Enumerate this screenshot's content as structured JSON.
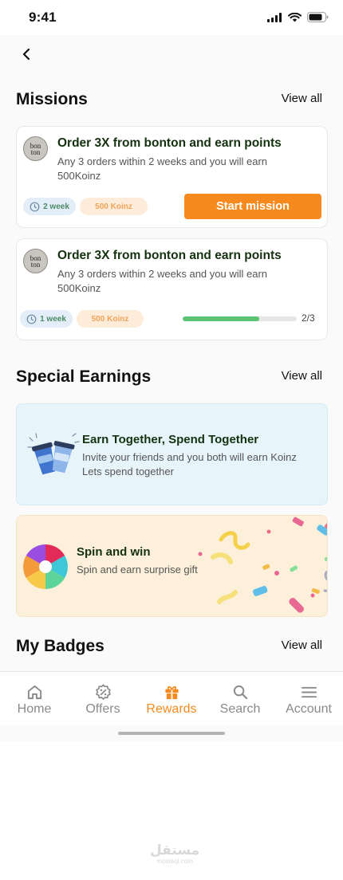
{
  "status_bar": {
    "time": "9:41"
  },
  "missions": {
    "title": "Missions",
    "view_all": "View all",
    "items": [
      {
        "logo_text": [
          "bon",
          "ton"
        ],
        "title": "Order 3X from bonton and earn points",
        "description": "Any 3 orders within 2 weeks and you will earn 500Koinz",
        "duration": "2 week",
        "reward": "500 Koinz",
        "action_label": "Start mission"
      },
      {
        "logo_text": [
          "bon",
          "ton"
        ],
        "title": "Order 3X from bonton and earn points",
        "description": "Any 3 orders within 2 weeks and you will earn 500Koinz",
        "duration": "1 week",
        "reward": "500 Koinz",
        "progress_fraction": 0.67,
        "progress_text": "2/3"
      }
    ]
  },
  "special_earnings": {
    "title": "Special Earnings",
    "view_all": "View all",
    "items": [
      {
        "title": "Earn Together, Spend Together",
        "description_line1": "Invite your friends and you both will earn Koinz",
        "description_line2": "Lets spend together",
        "icon": "coffee-cups-icon",
        "background": "#e7f5fb"
      },
      {
        "title": "Spin and win",
        "description": "Spin and earn surprise gift",
        "icon": "spin-wheel-icon",
        "background": "#fdf0db"
      }
    ]
  },
  "badges": {
    "title": "My Badges",
    "view_all": "View all"
  },
  "tab_bar": {
    "active": "Rewards",
    "items": [
      {
        "label": "Home",
        "icon": "home-icon"
      },
      {
        "label": "Offers",
        "icon": "offers-icon"
      },
      {
        "label": "Rewards",
        "icon": "gift-icon"
      },
      {
        "label": "Search",
        "icon": "search-icon"
      },
      {
        "label": "Account",
        "icon": "menu-icon"
      }
    ]
  },
  "colors": {
    "accent": "#f68a1f",
    "title_green": "#14320f",
    "progress_green": "#5cc474"
  },
  "watermark": {
    "arabic": "مستقل",
    "latin": "mostaql.com"
  }
}
